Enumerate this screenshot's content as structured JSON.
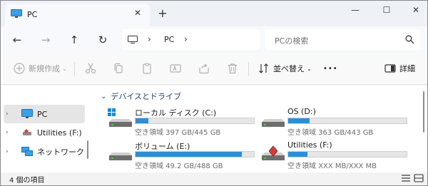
{
  "tab": {
    "title": "PC",
    "close": "✕",
    "new_tab": "+"
  },
  "window_controls": {
    "minimize": "—",
    "maximize": "☐",
    "close": "✕"
  },
  "nav": {
    "back": "←",
    "forward": "→",
    "up": "↑",
    "refresh": "↻"
  },
  "address": {
    "segment": "PC",
    "separator": "›"
  },
  "search": {
    "placeholder": "PCの検索"
  },
  "toolbar": {
    "new_label": "新規作成",
    "sort_label": "並べ替え",
    "more_label": "•••",
    "details_label": "詳細"
  },
  "sidebar": {
    "items": [
      {
        "label": "PC",
        "icon": "monitor-icon"
      },
      {
        "label": "Utilities (F:)",
        "icon": "usb-drive-icon"
      },
      {
        "label": "ネットワーク",
        "icon": "network-icon"
      }
    ]
  },
  "main": {
    "section_title": "デバイスとドライブ",
    "drives": [
      {
        "name": "ローカル ディスク (C:)",
        "free_text": "空き領域 397 GB/445 GB",
        "used_fraction": 0.11,
        "icon": "windows-drive-icon"
      },
      {
        "name": "OS (D:)",
        "free_text": "空き領域 363 GB/443 GB",
        "used_fraction": 0.18,
        "icon": "hard-drive-icon"
      },
      {
        "name": "ボリューム (E:)",
        "free_text": "空き領域 49.2 GB/488 GB",
        "used_fraction": 0.9,
        "icon": "hard-drive-icon"
      },
      {
        "name": "Utilities (F:)",
        "free_text": "空き領域 XXX MB/XXX MB",
        "used_fraction": 0.16,
        "icon": "removable-drive-icon"
      }
    ]
  },
  "status": {
    "item_count": "4 個の項目"
  },
  "colors": {
    "accent": "#2b8fd6",
    "section_header": "#1f3f7a"
  }
}
